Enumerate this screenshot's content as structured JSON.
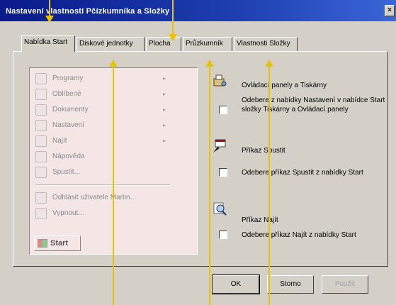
{
  "window": {
    "title": "Nastavení vlastností Pčízkumníka a Složky",
    "close_glyph": "×"
  },
  "tabs": [
    {
      "label": "Nabídka Start"
    },
    {
      "label": "Diskové jednotky"
    },
    {
      "label": "Plocha"
    },
    {
      "label": "Průzkumník"
    },
    {
      "label": "Vlastnosti Složky"
    }
  ],
  "start_menu": {
    "items": [
      {
        "label": "Programy",
        "icon": "programs-icon",
        "submenu": true
      },
      {
        "label": "Oblíbené",
        "icon": "favorites-icon",
        "submenu": true
      },
      {
        "label": "Dokumenty",
        "icon": "documents-icon",
        "submenu": true
      },
      {
        "label": "Nastavení",
        "icon": "settings-icon",
        "submenu": true
      },
      {
        "label": "Najít",
        "icon": "find-icon",
        "submenu": true
      },
      {
        "label": "Nápověda",
        "icon": "help-icon",
        "submenu": false
      },
      {
        "label": "Spustit...",
        "icon": "run-icon",
        "submenu": false
      },
      {
        "label": "Odhlásit uživatele Martin...",
        "icon": "logoff-icon",
        "submenu": false
      },
      {
        "label": "Vypnout...",
        "icon": "shutdown-icon",
        "submenu": false
      }
    ],
    "arrow_glyph": "▸",
    "start_label": "Start"
  },
  "options": {
    "taskbar": {
      "label": "Ovládací panely a Tiskárny",
      "checkbox_desc": "Odebere z nabídky Nastavení v nabídce Start složky Tiskárny a Ovládací panely",
      "checked": false
    },
    "run": {
      "label": "Příkaz Spustit",
      "checkbox_desc": "Odebere příkaz Spustit z nabídky Start",
      "checked": false
    },
    "find": {
      "label": "Příkaz Najít",
      "checkbox_desc": "Odebere příkaz Najít z nabídky Start",
      "checked": false
    }
  },
  "buttons": {
    "ok": "OK",
    "cancel": "Storno",
    "apply": "Použít"
  },
  "colors": {
    "title_bar": "#0a1a8a",
    "marker": "#e8c400",
    "menu_bg": "#f5e6e6"
  }
}
